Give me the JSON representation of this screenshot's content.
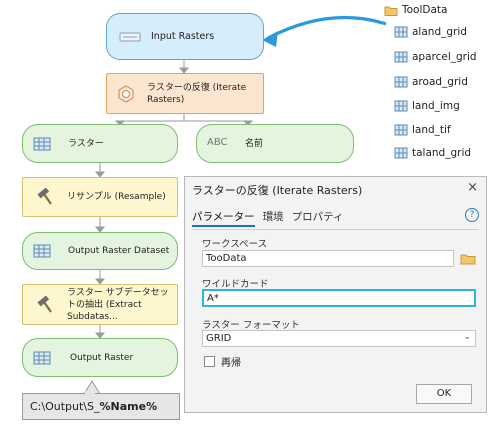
{
  "model": {
    "input_rasters": "Input Rasters",
    "iterate_rasters": "ラスターの反復 (Iterate Rasters)",
    "raster_var": "ラスター",
    "name_var_icon_text": "ABC",
    "name_var": "名前",
    "resample": "リサンプル (Resample)",
    "output_raster_dataset": "Output Raster Dataset",
    "extract_subdatasets": "ラスター サブデータセットの抽出 (Extract Subdatas...",
    "output_raster": "Output Raster"
  },
  "files": {
    "folder": "ToolData",
    "items": [
      "aland_grid",
      "aparcel_grid",
      "aroad_grid",
      "land_img",
      "land_tif",
      "taland_grid"
    ]
  },
  "dialog": {
    "title": "ラスターの反復 (Iterate Rasters)",
    "close": "×",
    "tabs": [
      "パラメーター",
      "環境",
      "プロパティ"
    ],
    "help": "?",
    "workspace_label": "ワークスペース",
    "workspace_value": "TooData",
    "wildcard_label": "ワイルドカード",
    "wildcard_value": "A*",
    "format_label": "ラスター フォーマット",
    "format_value": "GRID",
    "recursive_label": "再帰",
    "ok": "OK"
  },
  "tooltip": {
    "prefix": "C:\\Output\\S_",
    "bold": "%Name%"
  },
  "colors": {
    "blue_node": "#d6edfb",
    "orange_node": "#fde6cf",
    "green_node": "#e4f4df",
    "yellow_node": "#fdf6cf",
    "arrow": "#2a9ad8",
    "focus": "#30b4d8"
  }
}
